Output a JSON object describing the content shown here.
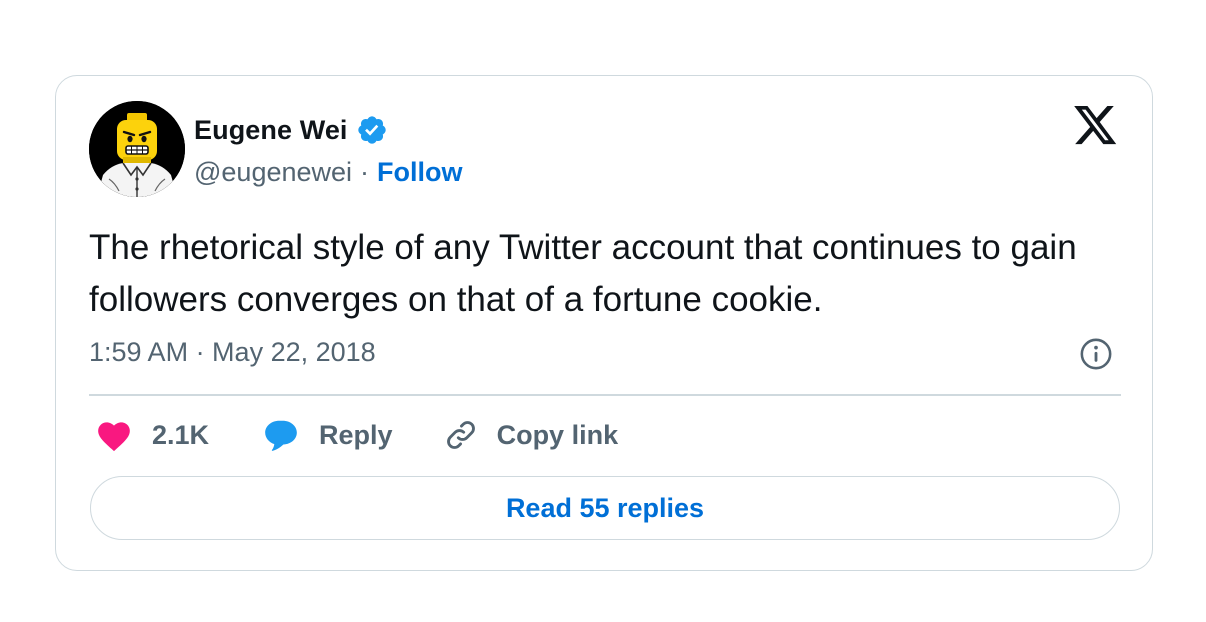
{
  "tweet": {
    "author": {
      "name": "Eugene Wei",
      "handle": "@eugenewei",
      "verified": true,
      "avatar": "lego-minifigure-avatar"
    },
    "separator": "·",
    "follow_label": "Follow",
    "text": "The rhetorical style of any Twitter account that continues to gain followers converges on that of a fortune cookie.",
    "timestamp": "1:59 AM · May 22, 2018",
    "likes": "2.1K",
    "reply_label": "Reply",
    "copy_link_label": "Copy link",
    "read_replies_label": "Read 55 replies"
  },
  "icons": {
    "brand": "x-logo-icon",
    "verified": "verified-badge-icon",
    "info": "info-icon",
    "like": "heart-icon",
    "reply": "speech-bubble-icon",
    "copy": "link-icon"
  },
  "colors": {
    "text": "#0f1419",
    "secondary": "#536471",
    "link_blue": "#006fd6",
    "verified_blue": "#1d9bf0",
    "heart_pink": "#f91880",
    "border": "#cfd9de"
  }
}
